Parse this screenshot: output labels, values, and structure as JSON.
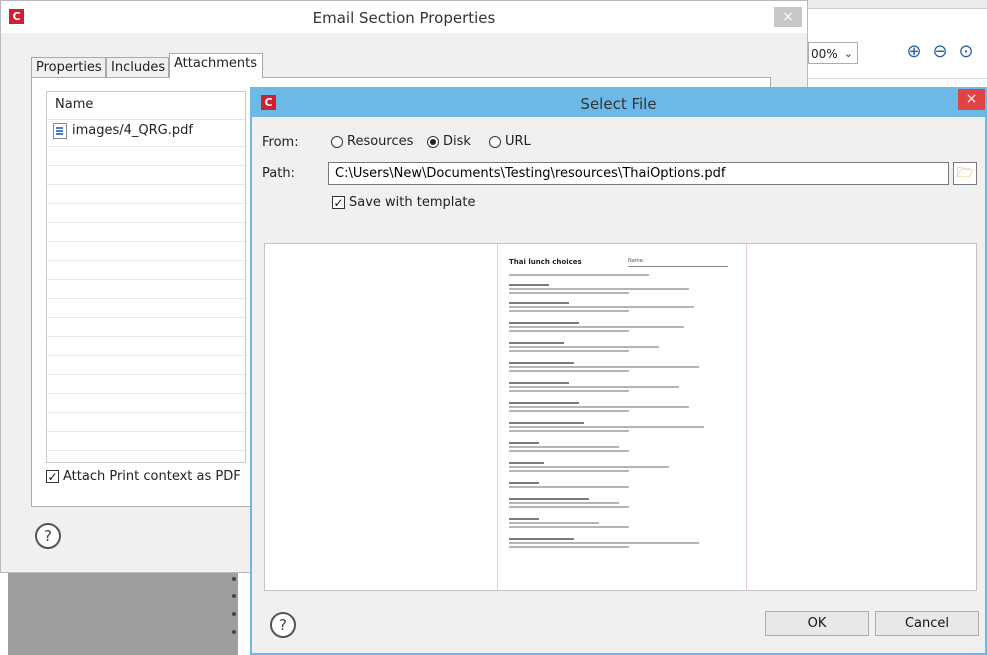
{
  "background_app": {
    "zoom_value": "00%",
    "zoom_in_icon": "zoom-in-icon",
    "zoom_out_icon": "zoom-out-icon",
    "zoom_reset_icon": "zoom-reset-icon"
  },
  "email_dialog": {
    "logo_letter": "C",
    "title": "Email Section Properties",
    "close_glyph": "×",
    "tabs": [
      "Properties",
      "Includes",
      "Attachments"
    ],
    "active_tab": "Attachments",
    "list_header": "Name",
    "attachments": [
      "images/4_QRG.pdf"
    ],
    "attach_print_label": "Attach Print context as PDF",
    "attach_print_checked": true,
    "help_glyph": "?"
  },
  "select_dialog": {
    "logo_letter": "C",
    "title": "Select File",
    "close_glyph": "×",
    "from_label": "From:",
    "from_options": [
      "Resources",
      "Disk",
      "URL"
    ],
    "from_selected": "Disk",
    "path_label": "Path:",
    "path_value": "C:\\Users\\New\\Documents\\Testing\\resources\\ThaiOptions.pdf",
    "browse_icon": "folder-open-icon",
    "save_template_label": "Save with template",
    "save_template_checked": true,
    "preview": {
      "doc_title": "Thai lunch choices",
      "name_field": "Name:"
    },
    "help_glyph": "?",
    "ok_label": "OK",
    "cancel_label": "Cancel"
  },
  "colors": {
    "select_titlebar": "#6cb9e8",
    "close_red": "#e04343",
    "logo_red": "#d0202f"
  }
}
